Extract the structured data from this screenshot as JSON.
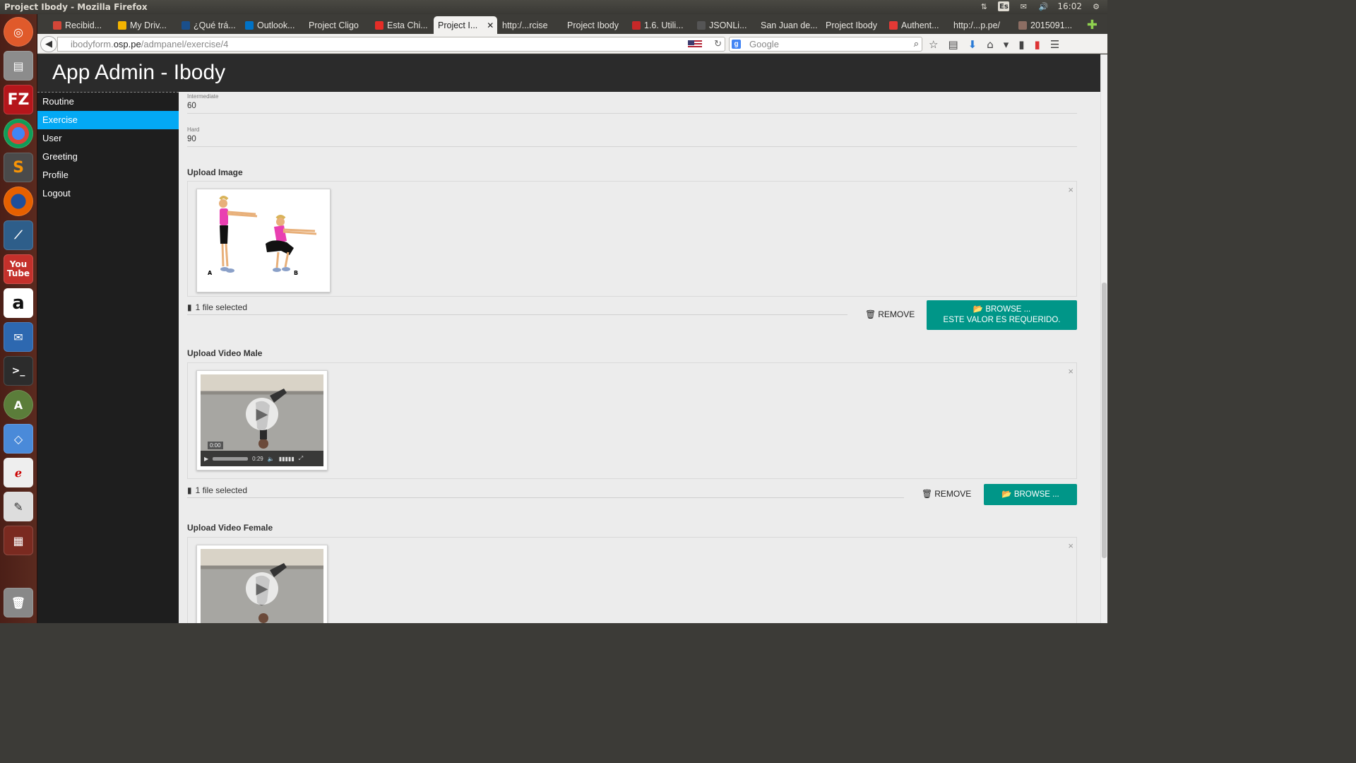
{
  "window_title": "Project Ibody - Mozilla Firefox",
  "tray": {
    "keyboard_layout": "Es",
    "clock": "16:02"
  },
  "tabs": [
    {
      "label": "Recibid...",
      "color": "#d44638"
    },
    {
      "label": "My Driv...",
      "color": "#f4b400"
    },
    {
      "label": "¿Qué trá...",
      "color": "#1a4f8b"
    },
    {
      "label": "Outlook...",
      "color": "#0072c6"
    },
    {
      "label": "Project Cligo",
      "color": ""
    },
    {
      "label": "Esta Chi...",
      "color": "#e52d27"
    },
    {
      "label": "Project I...",
      "color": ""
    },
    {
      "label": "http:/...rcise",
      "color": ""
    },
    {
      "label": "Project Ibody",
      "color": ""
    },
    {
      "label": "1.6. Utili...",
      "color": "#c62828"
    },
    {
      "label": "JSONLi...",
      "color": "#555555"
    },
    {
      "label": "San Juan de...",
      "color": ""
    },
    {
      "label": "Project Ibody",
      "color": ""
    },
    {
      "label": "Authent...",
      "color": "#e53935"
    },
    {
      "label": "http:/...p.pe/",
      "color": ""
    },
    {
      "label": "2015091...",
      "color": "#8d6e63"
    }
  ],
  "url": {
    "prefix": "ibodyform.",
    "host": "osp.pe",
    "path": "/admpanel/exercise/4"
  },
  "search_placeholder": "Google",
  "app_title": "App Admin - Ibody",
  "menu": [
    {
      "label": "Routine",
      "active": false
    },
    {
      "label": "Exercise",
      "active": true
    },
    {
      "label": "User",
      "active": false
    },
    {
      "label": "Greeting",
      "active": false
    },
    {
      "label": "Profile",
      "active": false
    },
    {
      "label": "Logout",
      "active": false
    }
  ],
  "fields": {
    "intermediate": {
      "label": "Intermediate",
      "value": "60"
    },
    "hard": {
      "label": "Hard",
      "value": "90"
    }
  },
  "uploads": {
    "image": {
      "title": "Upload Image",
      "file_status": "1 file selected",
      "remove": "REMOVE",
      "browse": "BROWSE ...",
      "error": "ESTE VALOR ES REQUERIDO.",
      "labels": {
        "a": "A",
        "b": "B"
      }
    },
    "video_male": {
      "title": "Upload Video Male",
      "file_status": "1 file selected",
      "remove": "REMOVE",
      "browse": "BROWSE ...",
      "time_tip": "0:00",
      "duration": "0:29"
    },
    "video_female": {
      "title": "Upload Video Female"
    }
  },
  "close_symbol": "×",
  "colors": {
    "accent": "#009688",
    "active_menu": "#03a9f4",
    "header": "#2b2b2b"
  }
}
